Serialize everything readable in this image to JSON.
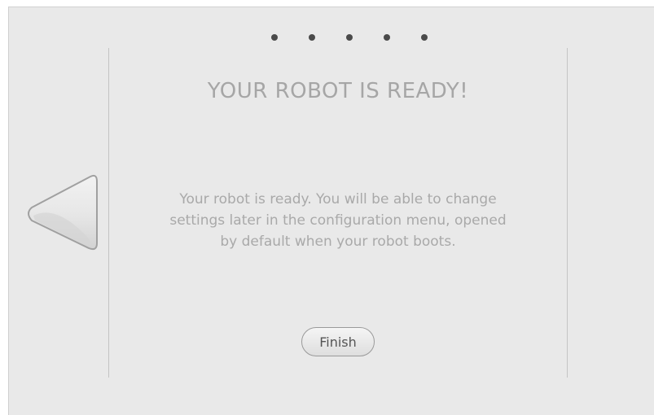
{
  "header": {
    "step_dots": [
      "step-1",
      "step-2",
      "step-3",
      "step-4",
      "step-5"
    ],
    "title": "YOUR ROBOT IS READY!"
  },
  "content": {
    "message_lines": [
      "Your robot is ready. You will be able to change",
      "settings later in the configuration menu, opened",
      "by default when your robot boots."
    ]
  },
  "navigation": {
    "back_icon": "triangle-left-icon",
    "finish_label": "Finish"
  },
  "colors": {
    "background": "#e9e9e9",
    "text": "#a9a9a9",
    "dot": "#4a4a4a"
  }
}
